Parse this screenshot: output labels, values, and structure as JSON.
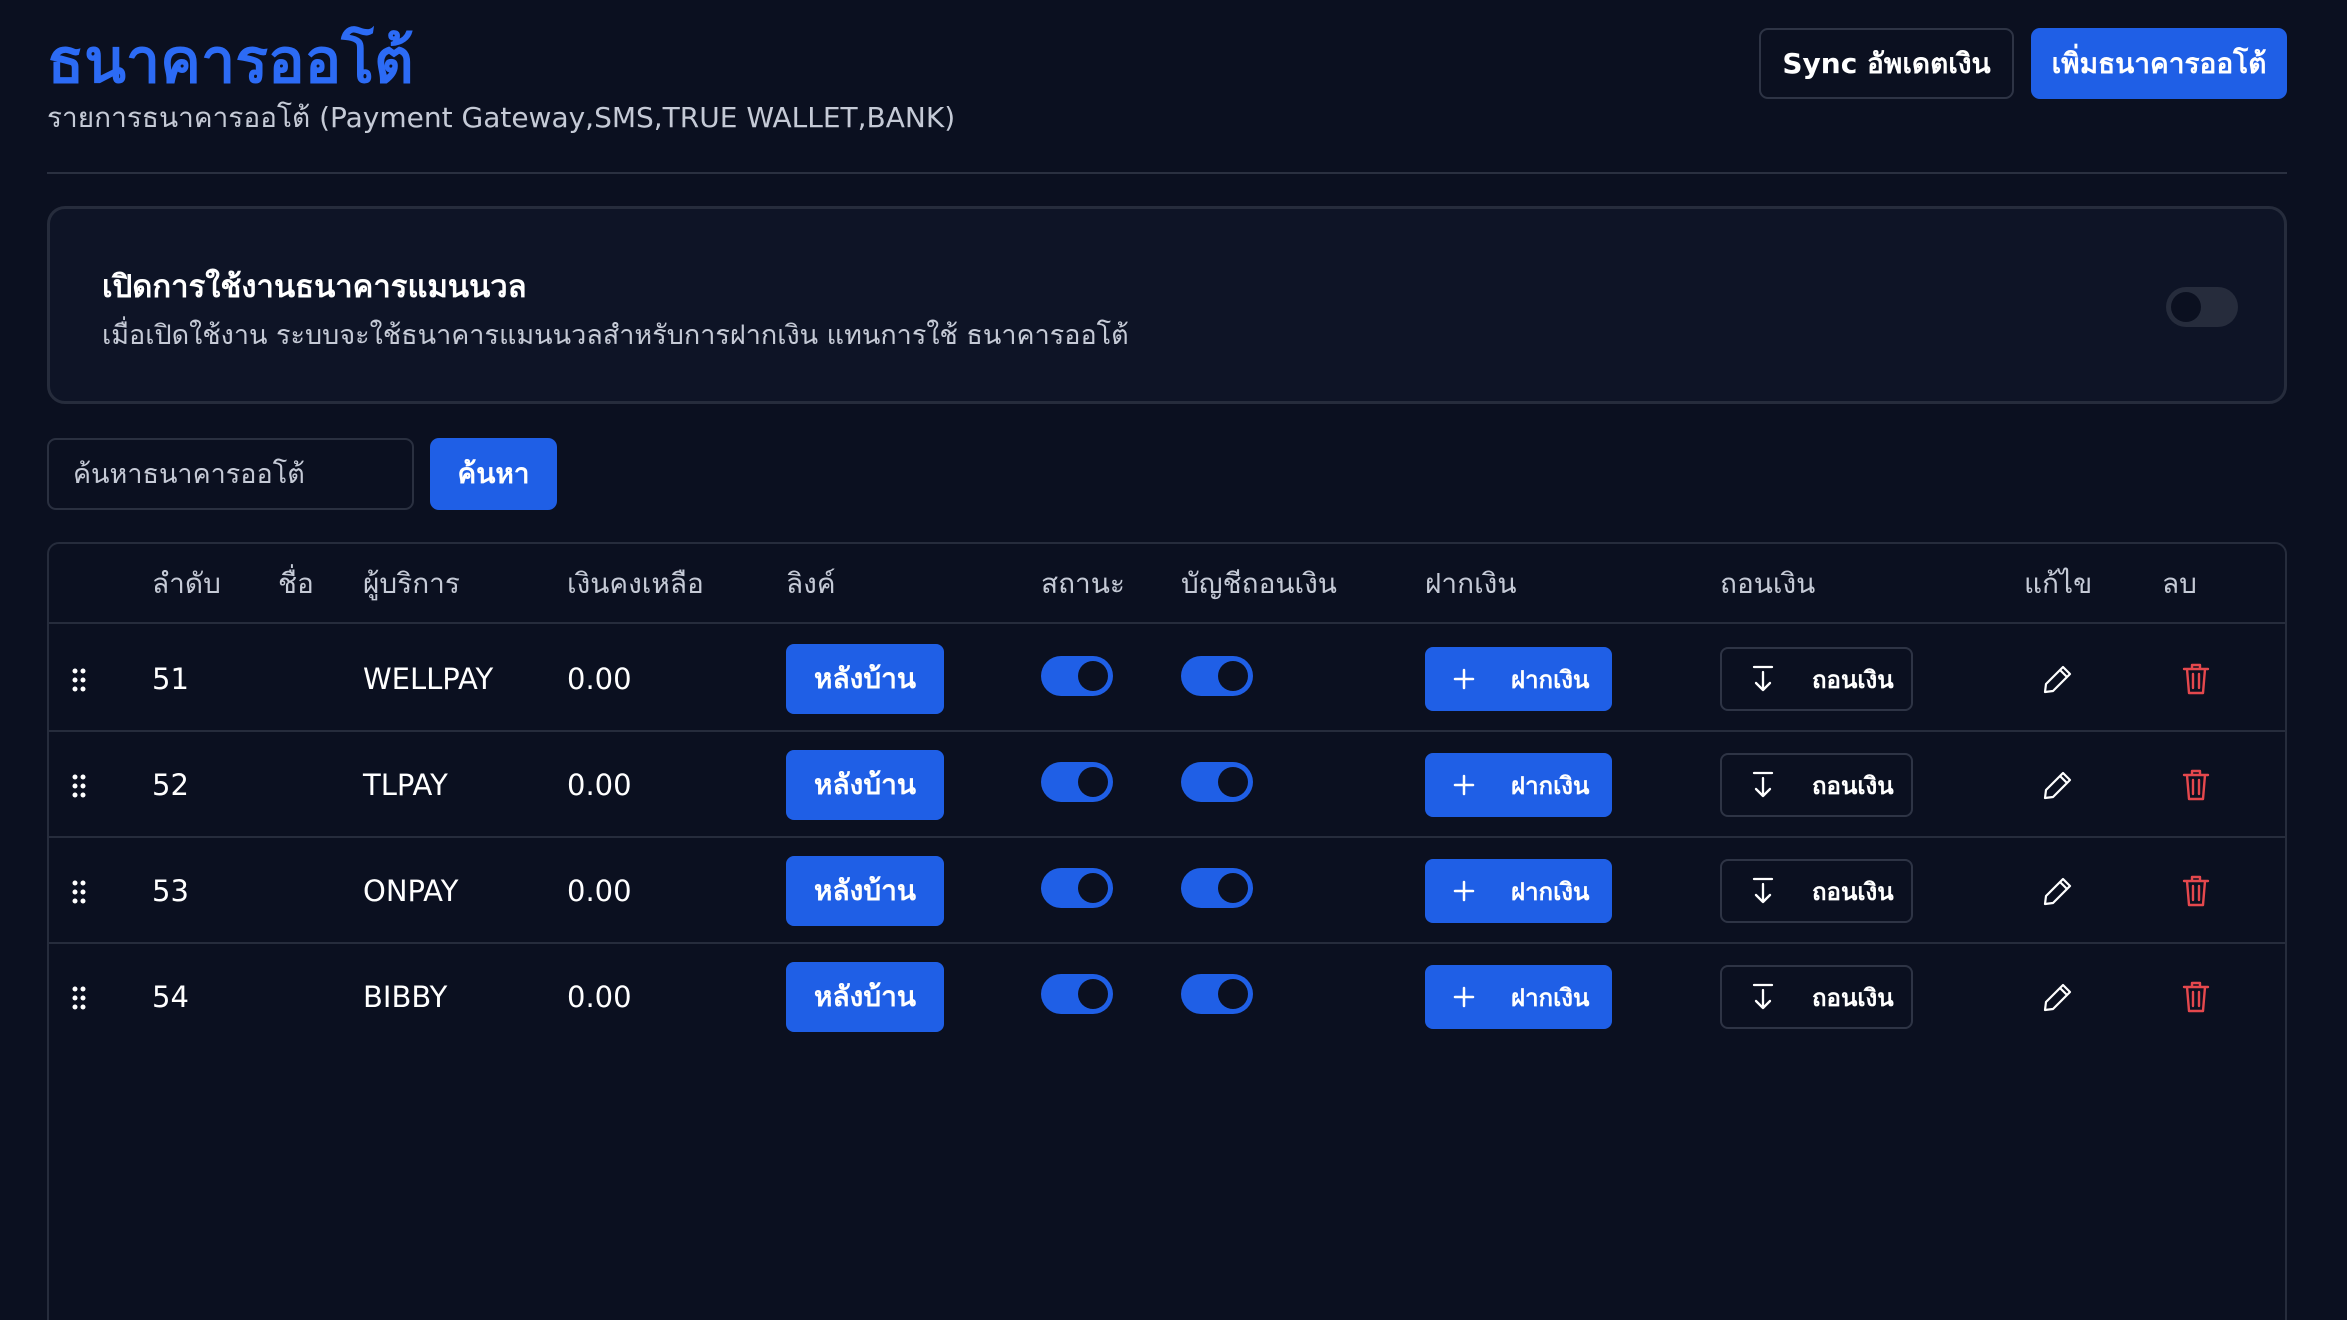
{
  "header": {
    "title": "ธนาคารออโต้",
    "subtitle": "รายการธนาคารออโต้ (Payment Gateway,SMS,TRUE WALLET,BANK)",
    "sync_label": "Sync อัพเดตเงิน",
    "add_label": "เพิ่มธนาคารออโต้"
  },
  "manual_bank": {
    "title": "เปิดการใช้งานธนาคารแมนนวล",
    "description": "เมื่อเปิดใช้งาน ระบบจะใช้ธนาคารแมนนวลสำหรับการฝากเงิน แทนการใช้ ธนาคารออโต้",
    "enabled": false
  },
  "search": {
    "placeholder": "ค้นหาธนาคารออโต้",
    "value": "",
    "button_label": "ค้นหา"
  },
  "table": {
    "headers": {
      "order": "ลำดับ",
      "name": "ชื่อ",
      "provider": "ผู้บริการ",
      "balance": "เงินคงเหลือ",
      "link": "ลิงค์",
      "status": "สถานะ",
      "withdraw_account": "บัญชีถอนเงิน",
      "deposit": "ฝากเงิน",
      "withdraw": "ถอนเงิน",
      "edit": "แก้ไข",
      "delete": "ลบ"
    },
    "rows": [
      {
        "order": "51",
        "name": "",
        "provider": "WELLPAY",
        "balance": "0.00",
        "link_label": "หลังบ้าน",
        "status": true,
        "withdraw_account": true,
        "deposit_label": "ฝากเงิน",
        "withdraw_label": "ถอนเงิน"
      },
      {
        "order": "52",
        "name": "",
        "provider": "TLPAY",
        "balance": "0.00",
        "link_label": "หลังบ้าน",
        "status": true,
        "withdraw_account": true,
        "deposit_label": "ฝากเงิน",
        "withdraw_label": "ถอนเงิน"
      },
      {
        "order": "53",
        "name": "",
        "provider": "ONPAY",
        "balance": "0.00",
        "link_label": "หลังบ้าน",
        "status": true,
        "withdraw_account": true,
        "deposit_label": "ฝากเงิน",
        "withdraw_label": "ถอนเงิน"
      },
      {
        "order": "54",
        "name": "",
        "provider": "BIBBY",
        "balance": "0.00",
        "link_label": "หลังบ้าน",
        "status": true,
        "withdraw_account": true,
        "deposit_label": "ฝากเงิน",
        "withdraw_label": "ถอนเงิน"
      }
    ]
  },
  "colors": {
    "background": "#0b1020",
    "primary": "#1f5fe6",
    "title": "#2c6bf5",
    "danger": "#e5484d",
    "muted_text": "#c5cad6",
    "border": "#262c3c"
  },
  "icons": {
    "drag": "grip-vertical-icon",
    "deposit": "plus-icon",
    "withdraw": "download-arrow-icon",
    "edit": "pencil-icon",
    "delete": "trash-icon"
  }
}
